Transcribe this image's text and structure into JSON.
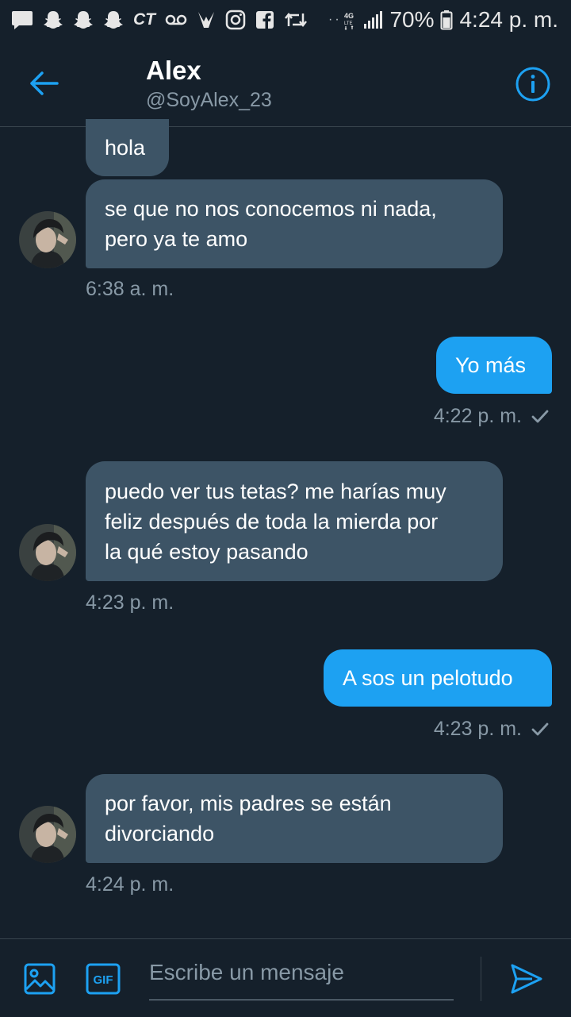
{
  "status_bar": {
    "ct_label": "CT",
    "dots": "··",
    "lte_label": "4G LTE",
    "battery": "70%",
    "time": "4:24 p. m."
  },
  "header": {
    "name": "Alex",
    "handle": "@SoyAlex_23"
  },
  "messages": [
    {
      "side": "in",
      "text": "hola"
    },
    {
      "side": "in",
      "lines": [
        "se que no nos conocemos ni nada,",
        "pero ya te amo"
      ]
    },
    {
      "side": "in",
      "time": "6:38 a. m."
    },
    {
      "side": "out",
      "text": "Yo más",
      "time": "4:22 p. m."
    },
    {
      "side": "in",
      "lines": [
        "puedo ver tus tetas? me harías muy",
        "feliz después de toda la mierda por",
        "la qué estoy pasando"
      ],
      "time": "4:23 p. m."
    },
    {
      "side": "out",
      "text": "A sos un pelotudo",
      "time": "4:23 p. m."
    },
    {
      "side": "in",
      "lines": [
        "por favor, mis padres se están",
        "divorciando"
      ],
      "time": "4:24 p. m."
    }
  ],
  "composer": {
    "placeholder": "Escribe un mensaje",
    "gif_label": "GIF"
  },
  "colors": {
    "background": "#15202b",
    "incoming_bubble": "#3d5466",
    "outgoing_bubble": "#1da1f2",
    "accent": "#1da1f2",
    "secondary_text": "#8899a6"
  }
}
